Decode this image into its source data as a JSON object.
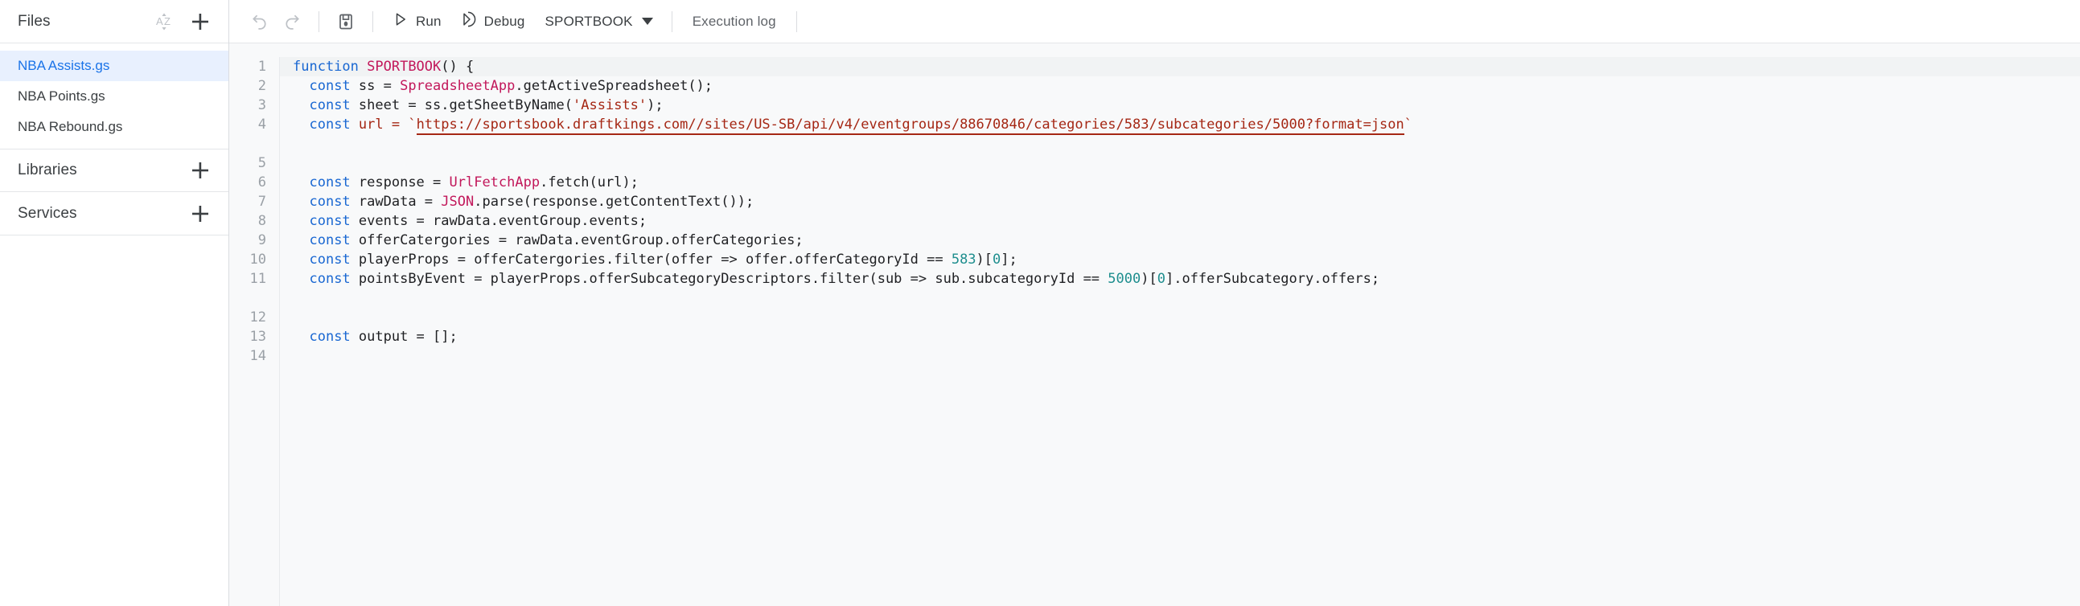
{
  "sidebar": {
    "files_section": {
      "title": "Files",
      "sort_icon": "sort-az-icon",
      "add_icon": "add-icon"
    },
    "files": [
      {
        "label": "NBA Assists.gs",
        "selected": true
      },
      {
        "label": "NBA Points.gs",
        "selected": false
      },
      {
        "label": "NBA Rebound.gs",
        "selected": false
      }
    ],
    "libraries_section": {
      "title": "Libraries",
      "add_icon": "add-icon"
    },
    "services_section": {
      "title": "Services",
      "add_icon": "add-icon"
    }
  },
  "toolbar": {
    "undo_icon": "undo-icon",
    "redo_icon": "redo-icon",
    "save_icon": "save-icon",
    "run_label": "Run",
    "run_icon": "play-icon",
    "debug_label": "Debug",
    "debug_icon": "debug-icon",
    "function_selected": "SPORTBOOK",
    "function_caret_icon": "chevron-down-icon",
    "execution_log_label": "Execution log"
  },
  "editor": {
    "line_numbers": [
      "1",
      "2",
      "3",
      "4",
      "5",
      "6",
      "7",
      "8",
      "9",
      "10",
      "11",
      "12",
      "13",
      "14"
    ],
    "code": {
      "l1_kw": "function",
      "l1_name": "SPORTBOOK",
      "l1_tail": "() {",
      "l2_kw": "const",
      "l2_mid": " ss = ",
      "l2_cls": "SpreadsheetApp",
      "l2_tail": ".getActiveSpreadsheet();",
      "l3_kw": "const",
      "l3_mid": " sheet = ss.getSheetByName(",
      "l3_str": "'Assists'",
      "l3_tail": ");",
      "l4_kw": "const",
      "l4_mid": " url = `",
      "l4_url_a": "https://sportsbook.draftkings.com//sites/US-SB/api/v4/eventgroups/88670846/categories/583/subcategories/5000?",
      "l4_url_b": "format=json",
      "l4_tail": "`",
      "l6_kw": "const",
      "l6_mid": " response = ",
      "l6_cls": "UrlFetchApp",
      "l6_tail": ".fetch(url);",
      "l7_kw": "const",
      "l7_mid": " rawData = ",
      "l7_cls": "JSON",
      "l7_tail": ".parse(response.getContentText());",
      "l8_kw": "const",
      "l8_tail": " events = rawData.eventGroup.events;",
      "l9_kw": "const",
      "l9_tail": " offerCatergories = rawData.eventGroup.offerCategories;",
      "l10_kw": "const",
      "l10_mid": " playerProps = offerCatergories.filter(offer => offer.offerCategoryId == ",
      "l10_num": "583",
      "l10_mid2": ")[",
      "l10_num2": "0",
      "l10_tail": "];",
      "l11_kw": "const",
      "l11_mid": " pointsByEvent = playerProps.offerSubcategoryDescriptors.filter(sub => sub.subcategoryId == ",
      "l11_num": "5000",
      "l11_mid2": ")[",
      "l11_num2": "0",
      "l11_tail": "].offerSubcategory.",
      "l11_wrap": "offers;",
      "l13_kw": "const",
      "l13_tail": " output = [];"
    }
  },
  "colors": {
    "accent": "#1a73e8",
    "selected_bg": "#e8f0fe",
    "keyword": "#1967d2",
    "class": "#c2185b",
    "string": "#a52714",
    "number": "#1e8e8e",
    "editor_bg": "#f8f9fa"
  }
}
